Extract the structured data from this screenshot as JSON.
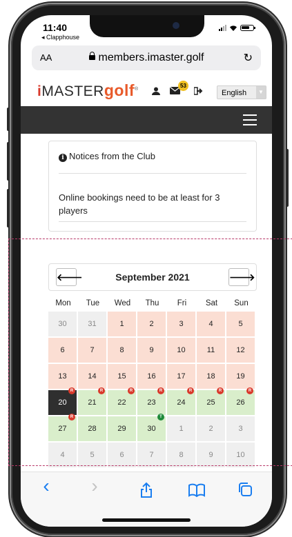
{
  "status": {
    "time": "11:40",
    "back_app": "◂ Clapphouse"
  },
  "browser": {
    "text_size": "AA",
    "url": "members.imaster.golf",
    "reload_icon": "↻"
  },
  "header": {
    "logo_i": "i",
    "logo_master": "MASTER",
    "logo_golf": "golf",
    "logo_reg": "®",
    "mail_count": "53",
    "language": "English"
  },
  "notice": {
    "title": "Notices from the Club",
    "body": "Online bookings need to be at least for 3 players"
  },
  "calendar": {
    "title": "September 2021",
    "prev_icon": "🡐",
    "next_icon": "🡒",
    "day_names": [
      "Mon",
      "Tue",
      "Wed",
      "Thu",
      "Fri",
      "Sat",
      "Sun"
    ],
    "weeks": [
      [
        {
          "d": "30",
          "s": "other"
        },
        {
          "d": "31",
          "s": "other"
        },
        {
          "d": "1",
          "s": "past"
        },
        {
          "d": "2",
          "s": "past"
        },
        {
          "d": "3",
          "s": "past"
        },
        {
          "d": "4",
          "s": "past"
        },
        {
          "d": "5",
          "s": "past"
        }
      ],
      [
        {
          "d": "6",
          "s": "past"
        },
        {
          "d": "7",
          "s": "past"
        },
        {
          "d": "8",
          "s": "past"
        },
        {
          "d": "9",
          "s": "past"
        },
        {
          "d": "10",
          "s": "past"
        },
        {
          "d": "11",
          "s": "past"
        },
        {
          "d": "12",
          "s": "past"
        }
      ],
      [
        {
          "d": "13",
          "s": "past"
        },
        {
          "d": "14",
          "s": "past"
        },
        {
          "d": "15",
          "s": "past"
        },
        {
          "d": "16",
          "s": "past"
        },
        {
          "d": "17",
          "s": "past"
        },
        {
          "d": "18",
          "s": "past"
        },
        {
          "d": "19",
          "s": "past"
        }
      ],
      [
        {
          "d": "20",
          "s": "today",
          "b": "R"
        },
        {
          "d": "21",
          "s": "open",
          "b": "R"
        },
        {
          "d": "22",
          "s": "open",
          "b": "R"
        },
        {
          "d": "23",
          "s": "open",
          "b": "R"
        },
        {
          "d": "24",
          "s": "open",
          "b": "R"
        },
        {
          "d": "25",
          "s": "open",
          "b": "R"
        },
        {
          "d": "26",
          "s": "open",
          "b": "R"
        }
      ],
      [
        {
          "d": "27",
          "s": "open",
          "b": "R"
        },
        {
          "d": "28",
          "s": "open"
        },
        {
          "d": "29",
          "s": "open"
        },
        {
          "d": "30",
          "s": "open",
          "b": "T"
        },
        {
          "d": "1",
          "s": "other"
        },
        {
          "d": "2",
          "s": "other"
        },
        {
          "d": "3",
          "s": "other"
        }
      ],
      [
        {
          "d": "4",
          "s": "other"
        },
        {
          "d": "5",
          "s": "other"
        },
        {
          "d": "6",
          "s": "other"
        },
        {
          "d": "7",
          "s": "other"
        },
        {
          "d": "8",
          "s": "other"
        },
        {
          "d": "9",
          "s": "other"
        },
        {
          "d": "10",
          "s": "other"
        }
      ]
    ]
  },
  "colors": {
    "past_day": "#fbded3",
    "open_day": "#d9eecb",
    "other_month": "#efefef",
    "today": "#2f2f2f",
    "badge_r": "#d9392b",
    "badge_t": "#1e8a3a",
    "ios_blue": "#1a7ef0",
    "highlight_dash": "#b83868"
  },
  "toolbar": {
    "back_icon": "‹",
    "forward_icon": "›",
    "share_icon": "⇧",
    "bookmarks_icon": "📖",
    "tabs_icon": "⧉"
  }
}
